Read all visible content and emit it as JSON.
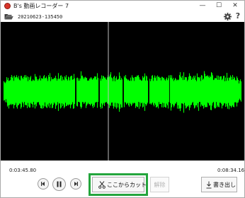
{
  "window": {
    "title": "B's 動画レコーダー 7",
    "controls": {
      "minimize": "—",
      "maximize": "☐",
      "close": "✕"
    }
  },
  "toolbar": {
    "file_name": "20210623-135450",
    "help": "?"
  },
  "waveform": {
    "color": "#00ff00",
    "background": "#000000",
    "cursor_color": "#bfbfbf"
  },
  "timeline": {
    "start_time": "0:03:45.80",
    "end_time": "0:08:34.16"
  },
  "buttons": {
    "cut_label": "ここからカット",
    "release_label": "解除",
    "export_label": "書き出し"
  },
  "accent_colors": {
    "highlight": "#24a53d",
    "app_icon": "#d8352a"
  }
}
